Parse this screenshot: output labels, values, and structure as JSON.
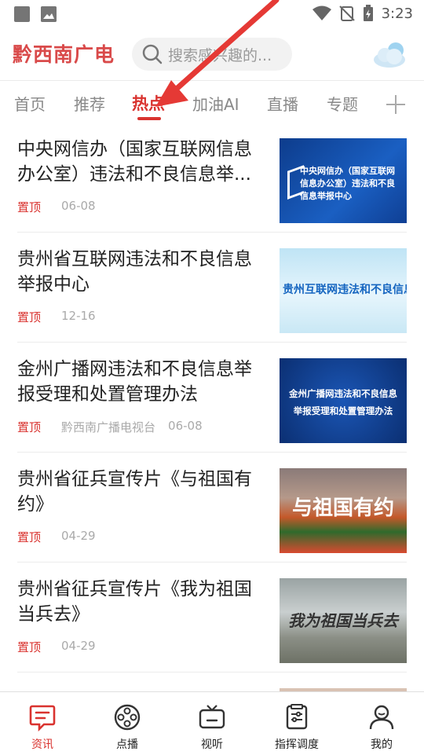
{
  "status_bar": {
    "time": "3:23"
  },
  "header": {
    "logo": "黔西南广电",
    "search_placeholder": "搜索感兴趣的..."
  },
  "tabs": [
    {
      "label": "首页"
    },
    {
      "label": "推荐"
    },
    {
      "label": "热点"
    },
    {
      "label": "加油AI"
    },
    {
      "label": "直播"
    },
    {
      "label": "专题"
    }
  ],
  "news": [
    {
      "title": "中央网信办（国家互联网信息办公室）违法和不良信息举...",
      "tag": "置顶",
      "source": "",
      "date": "06-08",
      "thumb_text": "中央网信办（国家互联网信息办公室）违法和不良信息举报中心"
    },
    {
      "title": "贵州省互联网违法和不良信息举报中心",
      "tag": "置顶",
      "source": "",
      "date": "12-16",
      "thumb_text": "贵州互联网违法和不良信息举报"
    },
    {
      "title": "金州广播网违法和不良信息举报受理和处置管理办法",
      "tag": "置顶",
      "source": "黔西南广播电视台",
      "date": "06-08",
      "thumb_text": "金州广播网违法和不良信息举报受理和处置管理办法"
    },
    {
      "title": "贵州省征兵宣传片《与祖国有约》",
      "tag": "置顶",
      "source": "",
      "date": "04-29",
      "thumb_text": "与祖国有约"
    },
    {
      "title": "贵州省征兵宣传片《我为祖国当兵去》",
      "tag": "置顶",
      "source": "",
      "date": "04-29",
      "thumb_text": "我为祖国当兵去"
    }
  ],
  "bottom_nav": [
    {
      "label": "资讯",
      "icon": "news-icon"
    },
    {
      "label": "点播",
      "icon": "film-reel-icon"
    },
    {
      "label": "视听",
      "icon": "tv-icon"
    },
    {
      "label": "指挥调度",
      "icon": "dispatch-icon"
    },
    {
      "label": "我的",
      "icon": "user-icon"
    }
  ],
  "colors": {
    "accent": "#d9332f",
    "logo": "#d94a4a"
  }
}
